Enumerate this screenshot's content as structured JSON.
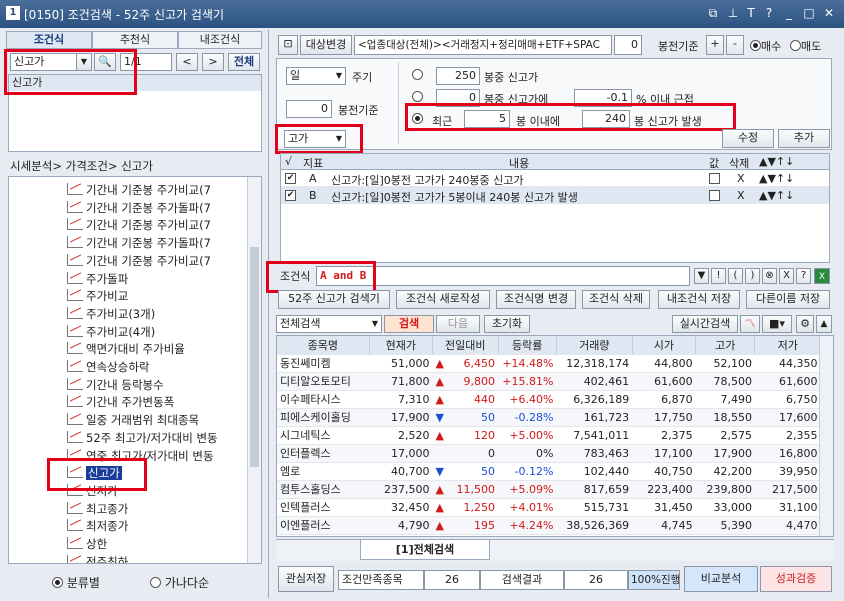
{
  "window": {
    "id": "1",
    "title": "[0150] 조건검색 - 52주 신고가 검색기"
  },
  "left": {
    "tabs": [
      "조건식",
      "추천식",
      "내조건식"
    ],
    "search_value": "신고가",
    "page": "1/1",
    "all_btn": "전체",
    "list": [
      "신고가"
    ],
    "breadcrumb": "시세분석> 가격조건> 신고가",
    "tree": [
      "기간내 기준봉 주가비교(7",
      "기간내 기준봉 주가돌파(7",
      "기간내 기준봉 주가비교(7",
      "기간내 기준봉 주가돌파(7",
      "기간내 기준봉 주가비교(7",
      "주가돌파",
      "주가비교",
      "주가비교(3개)",
      "주가비교(4개)",
      "액면가대비 주가비율",
      "연속상승하락",
      "기간내 등락봉수",
      "기간내 주가변동폭",
      "일중 거래범위 최대종목",
      "52주 최고가/저가대비 변동",
      "연중 최고가/저가대비 변동",
      "신고가",
      "신저가",
      "최고종가",
      "최저종가",
      "상한",
      "전주최하"
    ],
    "selected_tree_item": "신고가",
    "radio": [
      "분류별",
      "가나다순"
    ]
  },
  "cond": {
    "target_btn": "대상변경",
    "target_text": "<업종대상(전체)><거래정지+정리매매+ETF+SPAC",
    "base_num": "0",
    "base_label": "봉전기준",
    "plus": "+",
    "minus": "-",
    "buy": "매수",
    "sell": "매도",
    "period": "일",
    "period_label": "주기",
    "base2": "0",
    "base2_label": "봉전기준",
    "r1_num": "250",
    "r1_label": "봉중 신고가",
    "r2_num": "0",
    "r2_label": "봉중 신고가에",
    "r2_pct": "-0.1",
    "r2_tail": "% 이내 근접",
    "r3_pre": "최근",
    "r3_num": "5",
    "r3_mid": "봉 이내에",
    "r3_num2": "240",
    "r3_tail": "봉 신고가 발생",
    "price_type": "고가",
    "modify": "수정",
    "add": "추가"
  },
  "indicators": {
    "headers": [
      "지표",
      "내용",
      "값",
      "삭제"
    ],
    "rows": [
      {
        "id": "A",
        "text": "신고가:[일]0봉전 고가가 240봉중 신고가",
        "del": "X"
      },
      {
        "id": "B",
        "text": "신고가:[일]0봉전 고가가 5봉이내 240봉 신고가 발생",
        "del": "X"
      }
    ]
  },
  "formula": {
    "label": "조건식",
    "value": "A and B",
    "buttons": [
      "▼",
      "!",
      "(",
      ")",
      "⊗",
      "X",
      "?"
    ]
  },
  "actions": [
    "52주 신고가 검색기",
    "조건식 새로작성",
    "조건식명 변경",
    "조건식 삭제",
    "내조건식 저장",
    "다른이름 저장"
  ],
  "search": {
    "scope": "전체검색",
    "search": "검색",
    "next": "다음",
    "reset": "초기화",
    "realtime": "실시간검색"
  },
  "results": {
    "headers": [
      "종목명",
      "현재가",
      "전일대비",
      "등락률",
      "거래량",
      "시가",
      "고가",
      "저가"
    ],
    "rows": [
      {
        "name": "동진쎄미켐",
        "price": "51,000",
        "dir": "up",
        "chg": "6,450",
        "rate": "+14.48%",
        "vol": "12,318,174",
        "open": "44,800",
        "high": "52,100",
        "low": "44,350"
      },
      {
        "name": "디티알오토모티",
        "price": "71,800",
        "dir": "up",
        "chg": "9,800",
        "rate": "+15.81%",
        "vol": "402,461",
        "open": "61,600",
        "high": "78,500",
        "low": "61,600"
      },
      {
        "name": "이수페타시스",
        "price": "7,310",
        "dir": "up",
        "chg": "440",
        "rate": "+6.40%",
        "vol": "6,326,189",
        "open": "6,870",
        "high": "7,490",
        "low": "6,750"
      },
      {
        "name": "피에스케이홀딩",
        "price": "17,900",
        "dir": "down",
        "chg": "50",
        "rate": "-0.28%",
        "vol": "161,723",
        "open": "17,750",
        "high": "18,550",
        "low": "17,600"
      },
      {
        "name": "시그네틱스",
        "price": "2,520",
        "dir": "up",
        "chg": "120",
        "rate": "+5.00%",
        "vol": "7,541,011",
        "open": "2,375",
        "high": "2,575",
        "low": "2,355"
      },
      {
        "name": "인터플렉스",
        "price": "17,000",
        "dir": "none",
        "chg": "0",
        "rate": "0%",
        "vol": "783,463",
        "open": "17,100",
        "high": "17,900",
        "low": "16,800"
      },
      {
        "name": "엠로",
        "price": "40,700",
        "dir": "down",
        "chg": "50",
        "rate": "-0.12%",
        "vol": "102,440",
        "open": "40,750",
        "high": "42,200",
        "low": "39,950"
      },
      {
        "name": "컴투스홀딩스",
        "price": "237,500",
        "dir": "up",
        "chg": "11,500",
        "rate": "+5.09%",
        "vol": "817,659",
        "open": "223,400",
        "high": "239,800",
        "low": "217,500"
      },
      {
        "name": "인텍플러스",
        "price": "32,450",
        "dir": "up",
        "chg": "1,250",
        "rate": "+4.01%",
        "vol": "515,731",
        "open": "31,450",
        "high": "33,000",
        "low": "31,100"
      },
      {
        "name": "이엔플러스",
        "price": "4,790",
        "dir": "up",
        "chg": "195",
        "rate": "+4.24%",
        "vol": "38,526,369",
        "open": "4,745",
        "high": "5,390",
        "low": "4,470"
      }
    ],
    "tab": "[1]전체검색"
  },
  "status": {
    "save": "관심저장",
    "count_label": "조건만족종목",
    "count": "26",
    "result_label": "검색결과",
    "result": "26",
    "progress": "100%진행",
    "progress_value": 1.0,
    "compare": "비교분석",
    "perf": "성과검증"
  },
  "colors": {
    "up": "#d21a1a",
    "down": "#1a4fd2",
    "highlight": "#e3001b"
  }
}
